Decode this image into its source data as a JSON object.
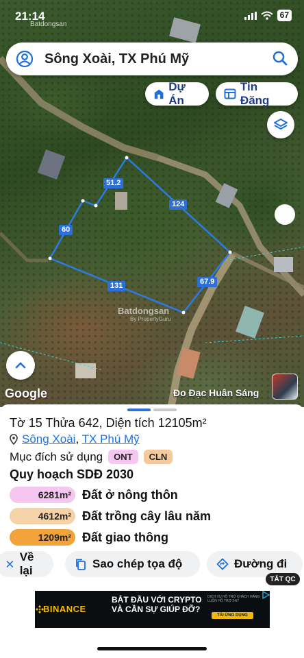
{
  "status_bar": {
    "time": "21:14",
    "battery": "67"
  },
  "map": {
    "watermark_top": "Batdongsan",
    "search_text": "Sông Xoài, TX Phú Mỹ",
    "chips": {
      "du_an": "Dự Án",
      "tin_dang": "Tin Đăng"
    },
    "edge_labels": {
      "top": "51.2",
      "left": "60",
      "right": "124",
      "bottom": "131",
      "bottom_right": "67.9"
    },
    "center_watermark": "Batdongsan",
    "center_watermark_sub": "By PropertyGuru",
    "google": "Google",
    "measure_label": "Đo Đạc Huân Sáng"
  },
  "parcel": {
    "title": "Tờ 15 Thửa 642, Diện tích 12105m²",
    "location_commune": "Sông Xoài",
    "location_separator": ", ",
    "location_town": "TX Phú Mỹ",
    "purpose_label": "Mục đích sử dụng",
    "purpose_tags": [
      "ONT",
      "CLN"
    ],
    "plan_heading": "Quy hoạch SDĐ 2030",
    "land_uses": [
      {
        "area": "6281m²",
        "name": "Đất ở nông thôn",
        "color": "#f4c6f0"
      },
      {
        "area": "4612m²",
        "name": "Đất trồng cây lâu năm",
        "color": "#f6d2a8"
      },
      {
        "area": "1209m²",
        "name": "Đất giao thông",
        "color": "#f2a43a"
      }
    ]
  },
  "actions": {
    "back": "Về lại",
    "copy": "Sao chép tọa độ",
    "route": "Đường đi"
  },
  "ad": {
    "label": "TẮT QC",
    "brand": "BINANCE",
    "headline_1": "BẮT ĐẦU VỚI CRYPTO",
    "headline_2": "VÀ CẦN SỰ GIÚP ĐỠ?",
    "sub": "DỊCH VỤ HỖ TRỢ KHÁCH HÀNG LUÔN HỖ TRỢ 24/7",
    "cta": "TẢI ỨNG DỤNG"
  },
  "colors": {
    "accent": "#2c6fd6",
    "nav": "#1e3a8a",
    "parcel_outline": "#2c7be5"
  }
}
